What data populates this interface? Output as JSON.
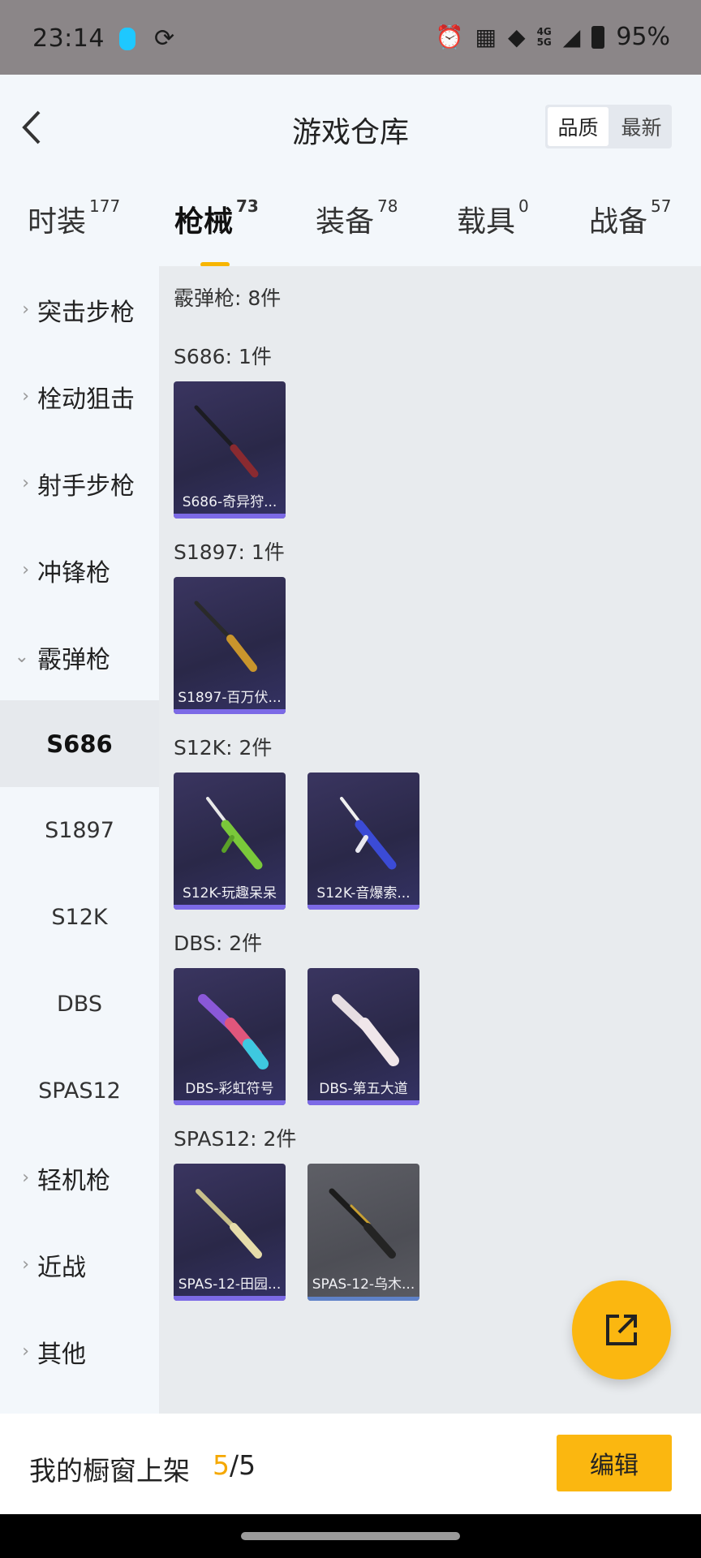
{
  "status_bar": {
    "time": "23:14",
    "network_top": "4G",
    "network_bottom": "5G",
    "battery": "95%",
    "icons": [
      "sync-icon",
      "alarm-icon",
      "nfc-icon",
      "wifi-icon",
      "signal-icon",
      "battery-icon"
    ]
  },
  "header": {
    "title": "游戏仓库",
    "sort_quality": "品质",
    "sort_latest": "最新"
  },
  "tabs": [
    {
      "label": "时装",
      "count": "177"
    },
    {
      "label": "枪械",
      "count": "73"
    },
    {
      "label": "装备",
      "count": "78"
    },
    {
      "label": "载具",
      "count": "0"
    },
    {
      "label": "战备",
      "count": "57"
    }
  ],
  "sidebar": {
    "categories_top": [
      "突击步枪",
      "栓动狙击",
      "射手步枪",
      "冲锋枪",
      "霰弹枪"
    ],
    "subcategories": [
      "S686",
      "S1897",
      "S12K",
      "DBS",
      "SPAS12"
    ],
    "categories_bottom": [
      "轻机枪",
      "近战",
      "其他"
    ]
  },
  "content": {
    "category_title": "霰弹枪: 8件",
    "groups": [
      {
        "title": "S686: 1件",
        "items": [
          "S686-奇异狩..."
        ]
      },
      {
        "title": "S1897: 1件",
        "items": [
          "S1897-百万伏..."
        ]
      },
      {
        "title": "S12K: 2件",
        "items": [
          "S12K-玩趣呆呆",
          "S12K-音爆索..."
        ]
      },
      {
        "title": "DBS: 2件",
        "items": [
          "DBS-彩虹符号",
          "DBS-第五大道"
        ]
      },
      {
        "title": "SPAS12: 2件",
        "items": [
          "SPAS-12-田园...",
          "SPAS-12-乌木..."
        ]
      }
    ]
  },
  "bottom_bar": {
    "label": "我的橱窗上架",
    "current": "5",
    "total": "/5",
    "edit_label": "编辑"
  },
  "colors": {
    "accent": "#fbb710",
    "card_bg": "#2f2c52",
    "card_bar": "#7c6ae6"
  }
}
